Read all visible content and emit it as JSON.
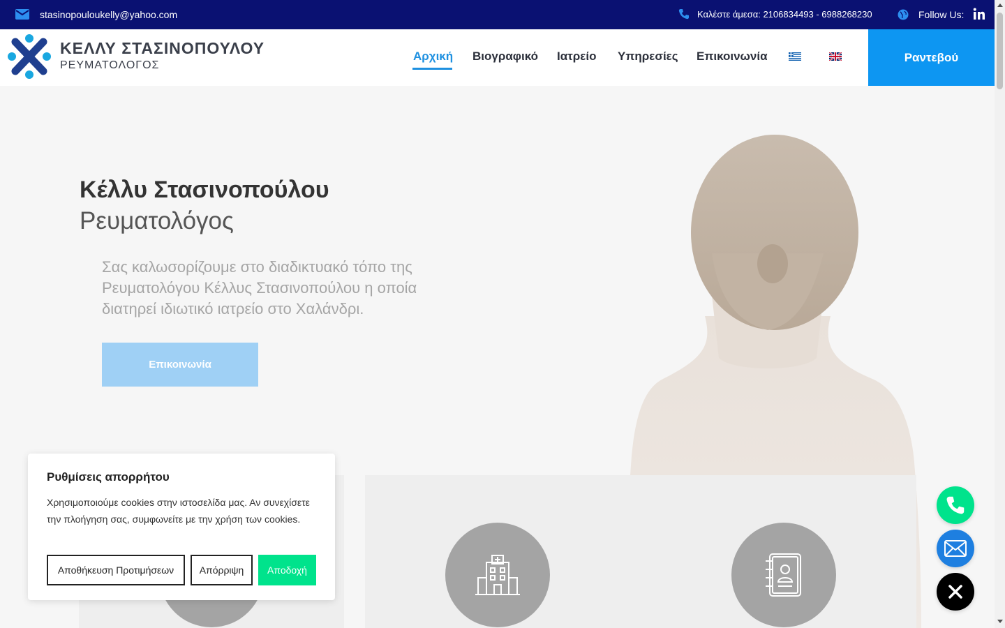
{
  "topbar": {
    "email": "stasinopouloukelly@yahoo.com",
    "phone": "Καλέστε άμεσα: 2106834493 - 6988268230",
    "follow": "Follow Us:",
    "linkedin_text": "in"
  },
  "header": {
    "logo_title": "ΚΕΛΛΥ ΣΤΑΣΙΝΟΠΟΥΛΟΥ",
    "logo_subtitle": "ΡΕΥΜΑΤΟΛΟΓΟΣ",
    "nav": [
      {
        "label": "Αρχική",
        "active": true
      },
      {
        "label": "Βιογραφικό"
      },
      {
        "label": "Ιατρείο"
      },
      {
        "label": "Υπηρεσίες"
      },
      {
        "label": "Επικοινωνία"
      }
    ],
    "appointment": "Ραντεβού"
  },
  "hero": {
    "title": "Κέλλυ Στασινοπούλου",
    "subtitle": "Ρευματολόγος",
    "text": "Σας καλωσορίζουμε στο διαδικτυακό τόπο της Ρευματολόγου Κέλλυς Στασινοπούλου η οποία διατηρεί ιδιωτικό ιατρείο στο Χαλάνδρι.",
    "button": "Επικοινωνία"
  },
  "cookie": {
    "title": "Ρυθμίσεις απορρήτου",
    "text": "Χρησιμοποιούμε cookies στην ιστοσελίδα μας. Αν συνεχίσετε την πλοήγηση σας, συμφωνείτε με την χρήση των cookies.",
    "save": "Αποθήκευση Προτιμήσεων",
    "reject": "Απόρριψη",
    "accept": "Αποδοχή"
  },
  "colors": {
    "topbar": "#0a1172",
    "accent": "#1e90e0",
    "appointment": "#0d96f2",
    "accept": "#00e38c",
    "fab_phone": "#00e38c",
    "fab_email": "#1e7fe0"
  },
  "icons": [
    "envelope-icon",
    "phone-icon",
    "globe-icon",
    "linkedin-icon",
    "greek-flag-icon",
    "uk-flag-icon",
    "hospital-icon",
    "address-book-icon",
    "close-icon"
  ]
}
